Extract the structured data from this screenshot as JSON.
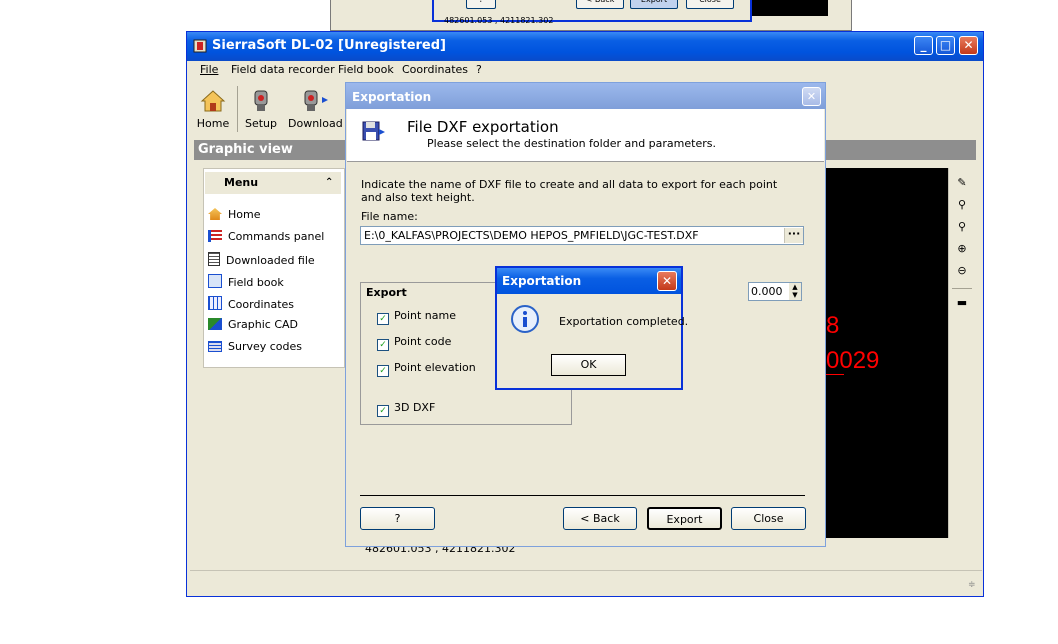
{
  "background_window": {
    "buttons": [
      "?",
      "< Back",
      "Export",
      "Close"
    ],
    "status": "482601.053 , 4211821.302"
  },
  "main_window": {
    "title": "SierraSoft DL-02 [Unregistered]",
    "title_buttons": {
      "minimize": "_",
      "maximize": "□",
      "close": "✕"
    },
    "menu": [
      "File",
      "Field data recorder",
      "Field book",
      "Coordinates",
      "?"
    ],
    "toolbar": {
      "home": "Home",
      "setup": "Setup",
      "download": "Download"
    },
    "section_title": "Graphic view",
    "left_panel": {
      "header": "Menu",
      "items": [
        "Home",
        "Commands panel",
        "Downloaded file",
        "Field book",
        "Coordinates",
        "Graphic CAD",
        "Survey codes"
      ]
    },
    "red_labels": [
      "8",
      "0029"
    ],
    "status_coords": "482601.053 , 4211821.302"
  },
  "export_dialog": {
    "title": "Exportation",
    "header_title": "File DXF exportation",
    "header_subtitle": "Please select the destination folder and parameters.",
    "description": "Indicate the name of DXF file to create and all data to export for each point and also text height.",
    "file_name_label": "File name:",
    "file_name_value": "E:\\0_KALFAS\\PROJECTS\\DEMO HEPOS_PMFIELD\\JGC-TEST.DXF",
    "browse_label": "···",
    "export_group": {
      "label": "Export",
      "options": [
        {
          "label": "Point name",
          "checked": true
        },
        {
          "label": "Point code",
          "checked": true
        },
        {
          "label": "Point elevation",
          "checked": true
        },
        {
          "label": "3D DXF",
          "checked": true
        }
      ]
    },
    "text_height_value": "0.000",
    "buttons": {
      "help": "?",
      "back": "< Back",
      "export": "Export",
      "close": "Close"
    }
  },
  "message_box": {
    "title": "Exportation",
    "message": "Exportation completed.",
    "ok": "OK"
  }
}
